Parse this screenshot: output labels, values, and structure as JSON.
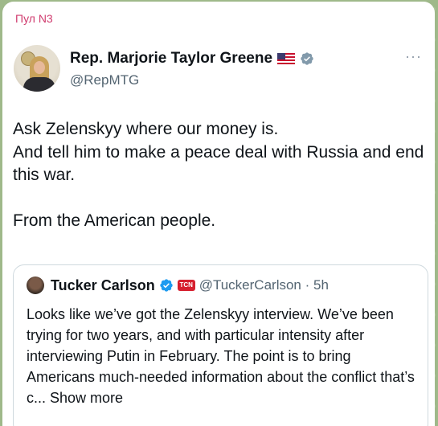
{
  "channel": {
    "name": "Пул N3"
  },
  "tweet": {
    "display_name": "Rep. Marjorie Taylor Greene",
    "handle": "@RepMTG",
    "more": "···",
    "lines": [
      "Ask Zelenskyy where our money is.",
      "And tell him to make a peace deal with Russia and end this war.",
      "",
      "From the American people."
    ]
  },
  "quote": {
    "name": "Tucker Carlson",
    "affiliate_badge": "TCN",
    "handle_time": "@TuckerCarlson · 5h",
    "text": "Looks like we’ve got the Zelenskyy interview. We’ve been trying for two years, and with particular intensity after interviewing Putin in February. The point is to bring Americans much-needed information about the conflict that’s c... Show more"
  },
  "colors": {
    "channel_name": "#d03c6f",
    "text_primary": "#0f1419",
    "text_secondary": "#536471",
    "verified_blue": "#1d9bf0",
    "government_grey": "#829aab",
    "card_border": "#cfd9de"
  },
  "icons": {
    "flag": "us-flag-icon",
    "gov_badge": "government-verified-icon",
    "blue_badge": "verified-check-icon",
    "more": "more-dots-icon"
  }
}
